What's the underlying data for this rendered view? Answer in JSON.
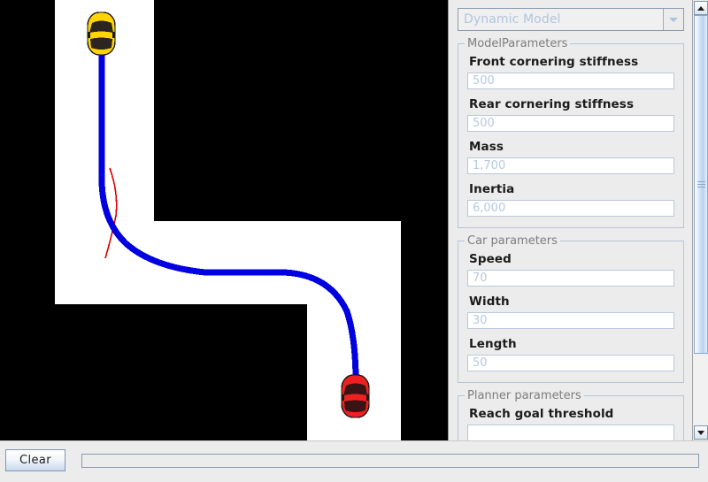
{
  "model_selector": {
    "value": "Dynamic Model",
    "arrow_icon": "chevron-down-icon"
  },
  "groups": [
    {
      "title": "ModelParameters",
      "fields": [
        {
          "label": "Front cornering stiffness",
          "value": "500"
        },
        {
          "label": "Rear cornering stiffness",
          "value": "500"
        },
        {
          "label": "Mass",
          "value": "1,700"
        },
        {
          "label": "Inertia",
          "value": "6,000"
        }
      ]
    },
    {
      "title": "Car parameters",
      "fields": [
        {
          "label": "Speed",
          "value": "70"
        },
        {
          "label": "Width",
          "value": "30"
        },
        {
          "label": "Length",
          "value": "50"
        }
      ]
    },
    {
      "title": "Planner parameters",
      "fields": [
        {
          "label": "Reach goal threshold",
          "value": ""
        }
      ]
    }
  ],
  "scrollbar": {
    "up_icon": "triangle-up-icon",
    "down_icon": "triangle-down-icon"
  },
  "bottom_bar": {
    "clear_label": "Clear",
    "status_value": ""
  },
  "map": {
    "background_color": "#000000",
    "free_space_color": "#ffffff",
    "path_color": "#0000e0",
    "branch_color": "#e00000",
    "start_car_color": "#ffd400",
    "goal_car_color": "#f02020",
    "start_car_label": "start-car-yellow",
    "goal_car_label": "goal-car-red"
  }
}
